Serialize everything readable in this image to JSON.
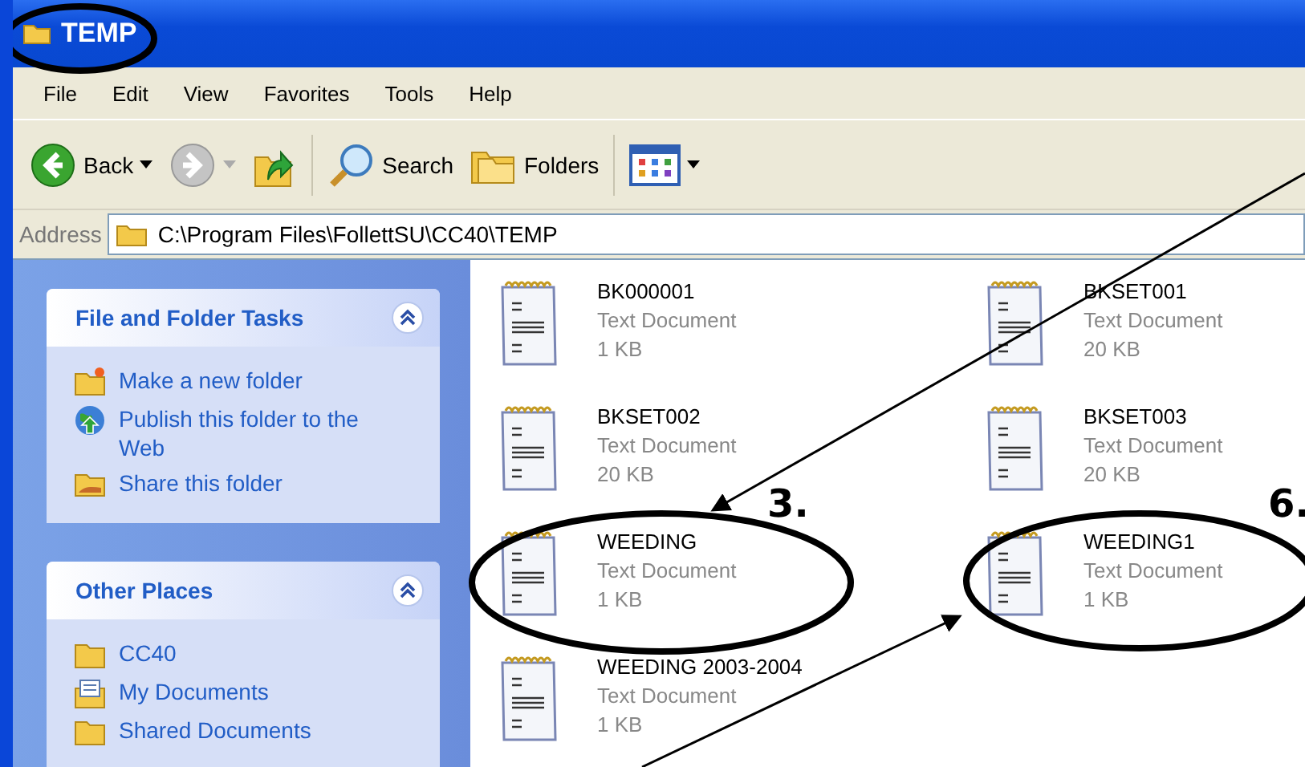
{
  "window": {
    "title": "TEMP"
  },
  "menu": [
    "File",
    "Edit",
    "View",
    "Favorites",
    "Tools",
    "Help"
  ],
  "toolbar": [
    {
      "kind": "back",
      "label": "Back",
      "disabled": false
    },
    {
      "kind": "forward",
      "disabled": true
    },
    {
      "kind": "up"
    },
    {
      "kind": "search",
      "label": "Search"
    },
    {
      "kind": "folders",
      "label": "Folders"
    },
    {
      "kind": "views"
    }
  ],
  "address": {
    "label": "Address",
    "value": "C:\\Program Files\\FollettSU\\CC40\\TEMP"
  },
  "sidebar": [
    {
      "title": "File and Folder Tasks",
      "expanded": true,
      "items": [
        {
          "kind": "new-folder",
          "label": "Make a new folder"
        },
        {
          "kind": "publish",
          "label": "Publish this folder to the Web"
        },
        {
          "kind": "share",
          "label": "Share this folder"
        }
      ]
    },
    {
      "title": "Other Places",
      "expanded": true,
      "items": [
        {
          "kind": "folder",
          "label": "CC40"
        },
        {
          "kind": "documents",
          "label": "My Documents"
        },
        {
          "kind": "folder",
          "label": "Shared Documents"
        }
      ]
    }
  ],
  "files": [
    {
      "name": "BK000001",
      "type": "Text Document",
      "size": "1 KB"
    },
    {
      "name": "BKSET001",
      "type": "Text Document",
      "size": "20 KB"
    },
    {
      "name": "BKSET002",
      "type": "Text Document",
      "size": "20 KB"
    },
    {
      "name": "BKSET003",
      "type": "Text Document",
      "size": "20 KB"
    },
    {
      "name": "WEEDING",
      "type": "Text Document",
      "size": "1 KB"
    },
    {
      "name": "WEEDING1",
      "type": "Text Document",
      "size": "1 KB"
    },
    {
      "name": "WEEDING 2003-2004",
      "type": "Text Document",
      "size": "1 KB"
    }
  ],
  "annotations": [
    {
      "label": "3."
    },
    {
      "label": "6."
    }
  ]
}
